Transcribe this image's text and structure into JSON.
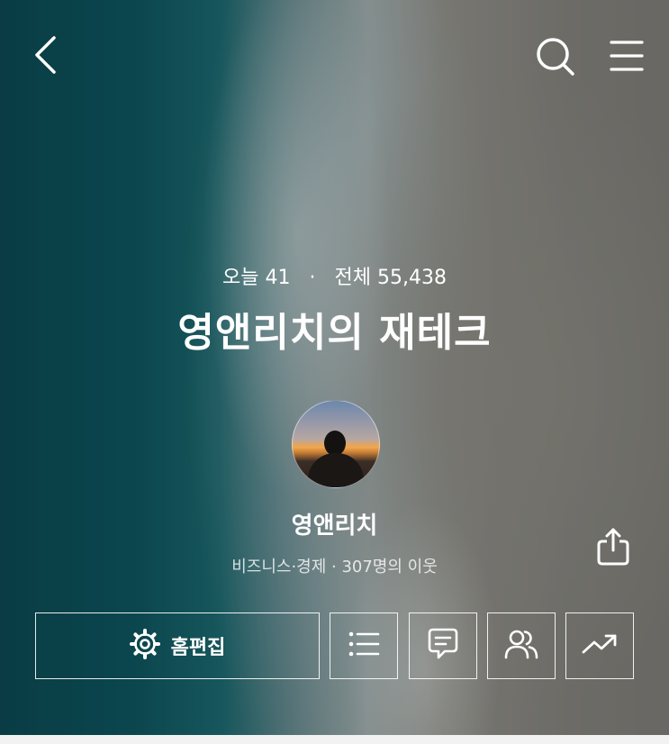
{
  "stats": {
    "today_label": "오늘",
    "today_count": "41",
    "separator": "·",
    "total_label": "전체",
    "total_count": "55,438"
  },
  "blog": {
    "title": "영앤리치의 재테크",
    "owner_name": "영앤리치",
    "meta": "비즈니스·경제 · 307명의 이웃"
  },
  "buttons": {
    "edit_home": "홈편집"
  },
  "icons": {
    "back": "chevron-left-icon",
    "search": "search-icon",
    "menu": "hamburger-menu-icon",
    "share": "share-icon",
    "settings": "gear-icon",
    "list": "list-icon",
    "chat": "comment-icon",
    "neighbors": "people-icon",
    "stats": "trending-up-icon"
  }
}
